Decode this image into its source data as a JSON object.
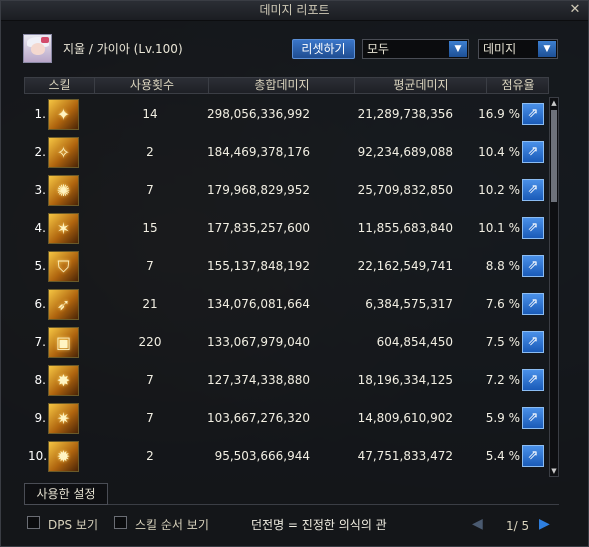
{
  "window": {
    "title": "데미지 리포트",
    "close_label": "✕"
  },
  "character": {
    "name": "지울 / 가이아 (Lv.100)"
  },
  "controls": {
    "reset_label": "리셋하기",
    "filter1": "모두",
    "filter2": "데미지"
  },
  "table": {
    "headers": [
      "스킬",
      "사용횟수",
      "총합데미지",
      "평균데미지",
      "점유율"
    ],
    "rows": [
      {
        "rank": "1.",
        "uses": "14",
        "total": "298,056,336,992",
        "avg": "21,289,738,356",
        "pct": "16.9 %",
        "icon": "skill-1-icon"
      },
      {
        "rank": "2.",
        "uses": "2",
        "total": "184,469,378,176",
        "avg": "92,234,689,088",
        "pct": "10.4 %",
        "icon": "skill-2-icon"
      },
      {
        "rank": "3.",
        "uses": "7",
        "total": "179,968,829,952",
        "avg": "25,709,832,850",
        "pct": "10.2 %",
        "icon": "skill-3-icon"
      },
      {
        "rank": "4.",
        "uses": "15",
        "total": "177,835,257,600",
        "avg": "11,855,683,840",
        "pct": "10.1 %",
        "icon": "skill-4-icon"
      },
      {
        "rank": "5.",
        "uses": "7",
        "total": "155,137,848,192",
        "avg": "22,162,549,741",
        "pct": "8.8 %",
        "icon": "skill-5-icon"
      },
      {
        "rank": "6.",
        "uses": "21",
        "total": "134,076,081,664",
        "avg": "6,384,575,317",
        "pct": "7.6 %",
        "icon": "skill-6-icon"
      },
      {
        "rank": "7.",
        "uses": "220",
        "total": "133,067,979,040",
        "avg": "604,854,450",
        "pct": "7.5 %",
        "icon": "skill-7-icon"
      },
      {
        "rank": "8.",
        "uses": "7",
        "total": "127,374,338,880",
        "avg": "18,196,334,125",
        "pct": "7.2 %",
        "icon": "skill-8-icon"
      },
      {
        "rank": "9.",
        "uses": "7",
        "total": "103,667,276,320",
        "avg": "14,809,610,902",
        "pct": "5.9 %",
        "icon": "skill-9-icon"
      },
      {
        "rank": "10.",
        "uses": "2",
        "total": "95,503,666,944",
        "avg": "47,751,833,472",
        "pct": "5.4 %",
        "icon": "skill-10-icon"
      }
    ]
  },
  "footer": {
    "tab_label": "사용한 설정",
    "dps_label": "DPS 보기",
    "order_label": "스킬 순서 보기",
    "dungeon_label": "던전명 = 진정한 의식의 관",
    "page": "1/ 5"
  }
}
